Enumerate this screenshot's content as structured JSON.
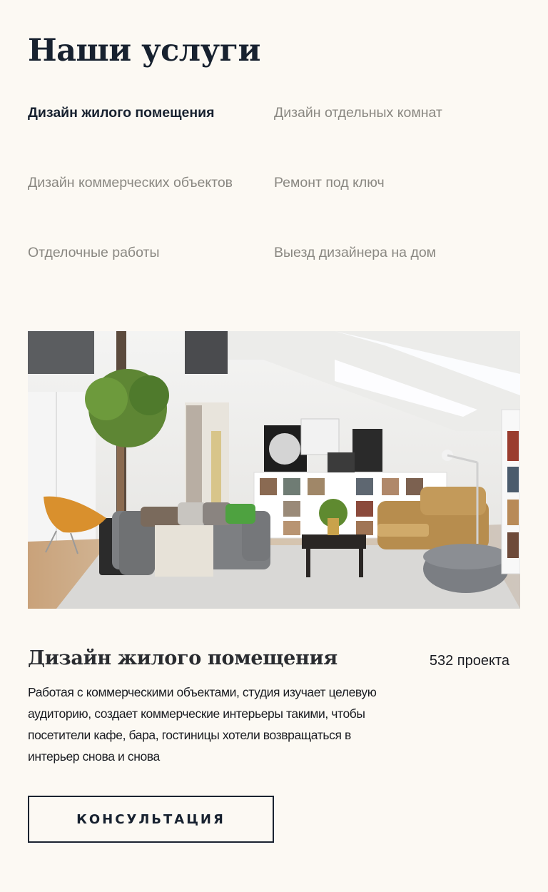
{
  "header": {
    "title": "Наши услуги"
  },
  "tabs": [
    {
      "label": "Дизайн жилого помещения",
      "active": true
    },
    {
      "label": "Дизайн отдельных комнат",
      "active": false
    },
    {
      "label": "Дизайн коммерческих объектов",
      "active": false
    },
    {
      "label": "Ремонт под ключ",
      "active": false
    },
    {
      "label": "Отделочные работы",
      "active": false
    },
    {
      "label": "Выезд дизайнера на дом",
      "active": false
    }
  ],
  "service": {
    "title": "Дизайн жилого помещения",
    "project_count": "532 проекта",
    "description": "Работая с коммерческими объектами, студия изучает целевую аудиторию, создает коммерческие интерьеры такими, чтобы посетители кафе, бара, гостиницы хотели возвращаться в интерьер снова и снова",
    "image": "living-room-interior-photo"
  },
  "cta": {
    "label": "КОНСУЛЬТАЦИЯ"
  },
  "colors": {
    "background": "#fcf9f3",
    "text_dark": "#17212f",
    "text_muted": "#8a8882"
  }
}
